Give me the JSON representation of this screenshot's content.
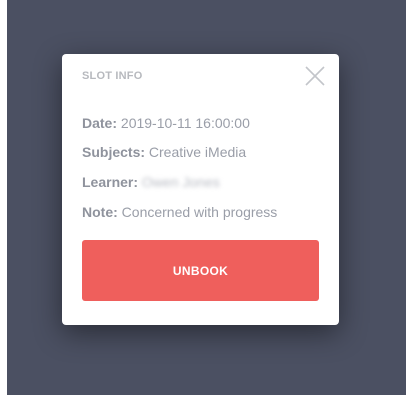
{
  "modal": {
    "title": "SLOT INFO",
    "fields": {
      "date_label": "Date:",
      "date_value": "2019-10-11 16:00:00",
      "subjects_label": "Subjects:",
      "subjects_value": "Creative iMedia",
      "learner_label": "Learner:",
      "learner_value": "Owen Jones",
      "note_label": "Note:",
      "note_value": "Concerned with progress"
    },
    "unbook_label": "UNBOOK",
    "close_icon": "close-icon"
  },
  "colors": {
    "backdrop": "#4b5062",
    "accent": "#ef5f5c",
    "text": "#9a9ea8"
  }
}
